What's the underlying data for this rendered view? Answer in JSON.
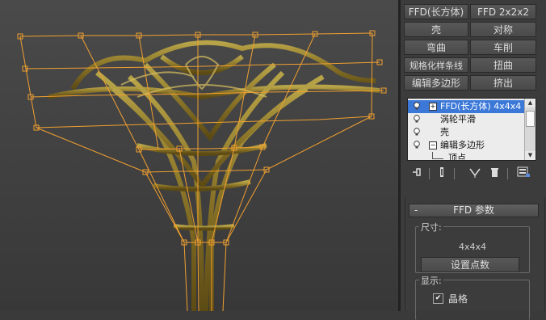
{
  "modifier_list": {
    "buttons": [
      "FFD(长方体)",
      "FFD 2x2x2",
      "壳",
      "对称",
      "弯曲",
      "车削",
      "规格化样条线",
      "扭曲",
      "编辑多边形",
      "挤出"
    ]
  },
  "modifier_stack": {
    "items": [
      {
        "label": "FFD(长方体) 4x4x4",
        "expander": "+",
        "selected": true
      },
      {
        "label": "涡轮平滑",
        "expander": "",
        "selected": false
      },
      {
        "label": "壳",
        "expander": "",
        "selected": false
      },
      {
        "label": "编辑多边形",
        "expander": "−",
        "selected": false
      },
      {
        "label": "顶点",
        "expander": "",
        "selected": false
      }
    ]
  },
  "stack_toolbar": {
    "icons": [
      "pin-stack-icon",
      "show-end-result-icon",
      "make-unique-icon",
      "remove-modifier-icon",
      "configure-modifier-sets-icon"
    ]
  },
  "ffd_params": {
    "title": "FFD 参数",
    "collapse_symbol": "-",
    "size_group_label": "尺寸:",
    "size_value": "4x4x4",
    "set_points_button": "设置点数",
    "display_group_label": "显示:",
    "lattice_label": "晶格",
    "lattice_checked": true,
    "check_mark": "✔"
  },
  "colors": {
    "lattice": "#f0a030",
    "model": "#8c7a30",
    "selection": "#3b78d8"
  }
}
